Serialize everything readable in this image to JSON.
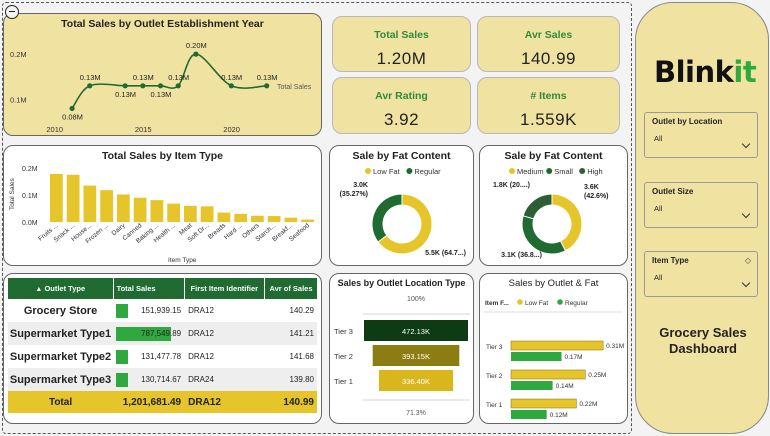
{
  "colors": {
    "yellow": "#e6c52a",
    "dark_green": "#1f6b32",
    "green": "#2fa83f",
    "olive": "#8b7d12",
    "card_bg": "#f0e3a2"
  },
  "kpis": [
    {
      "label": "Total Sales",
      "value": "1.20M"
    },
    {
      "label": "Avr Sales",
      "value": "140.99"
    },
    {
      "label": "Avr Rating",
      "value": "3.92"
    },
    {
      "label": "# Items",
      "value": "1.559K"
    }
  ],
  "sidebar": {
    "logo_main": "Blink",
    "logo_accent": "it",
    "slicers": [
      {
        "label": "Outlet by Location",
        "value": "All"
      },
      {
        "label": "Outlet Size",
        "value": "All"
      },
      {
        "label": "Item Type",
        "value": "All"
      }
    ],
    "title_line1": "Grocery Sales",
    "title_line2": "Dashboard"
  },
  "table": {
    "headers": [
      "Outlet Type",
      "Total Sales",
      "First Item Identifier",
      "Avr of Sales"
    ],
    "rows": [
      {
        "name": "Grocery Store",
        "sales": "151,939.15",
        "sales_frac": 0.19,
        "first": "DRA12",
        "avg": "140.29"
      },
      {
        "name": "Supermarket Type1",
        "sales": "787,549.89",
        "sales_frac": 1.0,
        "first": "DRA12",
        "avg": "141.21"
      },
      {
        "name": "Supermarket Type2",
        "sales": "131,477.78",
        "sales_frac": 0.17,
        "first": "DRA12",
        "avg": "141.68"
      },
      {
        "name": "Supermarket Type3",
        "sales": "130,714.67",
        "sales_frac": 0.17,
        "first": "DRA24",
        "avg": "139.80"
      }
    ],
    "total": {
      "name": "Total",
      "sales": "1,201,681.49",
      "first": "DRA12",
      "avg": "140.99"
    }
  },
  "chart_data": [
    {
      "id": "year",
      "type": "line",
      "title": "Total Sales by Outlet Establishment Year",
      "x": [
        2011,
        2012,
        2014,
        2015,
        2016,
        2017,
        2018,
        2020,
        2022
      ],
      "values": [
        0.08,
        0.13,
        0.13,
        0.13,
        0.13,
        0.13,
        0.2,
        0.13,
        0.13
      ],
      "point_labels": [
        "0.08M",
        "0.13M",
        "0.13M",
        "0.13M",
        "0.13M",
        "0.13M",
        "0.20M",
        "0.13M",
        "0.13M"
      ],
      "series": [
        {
          "name": "Total Sales"
        }
      ],
      "y_ticks": [
        "0.1M",
        "0.2M"
      ],
      "x_ticks": [
        "2010",
        "2015",
        "2020"
      ],
      "ylim": [
        0.05,
        0.24
      ]
    },
    {
      "id": "itemtype",
      "type": "bar",
      "title": "Total Sales by Item Type",
      "categories": [
        "Fruits ...",
        "Snack ...",
        "House...",
        "Frozen ...",
        "Dairy",
        "Canned",
        "Baking ...",
        "Health ...",
        "Meat",
        "Soft Dr...",
        "Breads",
        "Hard ...",
        "Others",
        "Starch...",
        "Breakf...",
        "Seafood"
      ],
      "values": [
        0.178,
        0.175,
        0.135,
        0.118,
        0.102,
        0.09,
        0.081,
        0.068,
        0.06,
        0.058,
        0.035,
        0.03,
        0.023,
        0.022,
        0.016,
        0.009
      ],
      "xlabel": "Item Type",
      "ylabel": "Total Sales",
      "y_ticks": [
        "0.0M",
        "0.1M",
        "0.2M"
      ],
      "ylim": [
        0,
        0.2
      ]
    },
    {
      "id": "fat",
      "type": "pie",
      "title": "Sale by Fat Content",
      "legend": [
        "Low Fat",
        "Regular"
      ],
      "values": [
        64.73,
        35.27
      ],
      "labels": [
        "5.5K (64.7...)",
        "3.0K\n(35.27%)"
      ],
      "colors": [
        "#e6c52a",
        "#1f6b32"
      ]
    },
    {
      "id": "size",
      "type": "pie",
      "title": "Sale by Fat Content",
      "legend": [
        "Medium",
        "Small",
        "High"
      ],
      "values": [
        42.6,
        36.8,
        20.6
      ],
      "labels": [
        "3.6K\n(42.6%)",
        "3.1K (36.8...)",
        "1.8K (20....)"
      ],
      "colors": [
        "#e6c52a",
        "#1f6b32",
        "#2e5e34"
      ]
    },
    {
      "id": "location",
      "type": "bar",
      "title": "Sales by Outlet Location Type",
      "categories": [
        "Tier 3",
        "Tier 2",
        "Tier 1"
      ],
      "values": [
        472.13,
        393.15,
        336.4
      ],
      "value_labels": [
        "472.13K",
        "393.15K",
        "336.40K"
      ],
      "top_label": "100%",
      "bottom_label": "71.3%",
      "colors": [
        "#0d3b14",
        "#8b7d12",
        "#d9b71c"
      ]
    },
    {
      "id": "outletfat",
      "type": "bar",
      "title": "Sales by Outlet & Fat",
      "legend_title": "Item F...",
      "categories": [
        "Tier 3",
        "Tier 2",
        "Tier 1"
      ],
      "series": [
        {
          "name": "Low Fat",
          "values": [
            0.31,
            0.25,
            0.22
          ],
          "labels": [
            "0.31M",
            "0.25M",
            "0.22M"
          ]
        },
        {
          "name": "Regular",
          "values": [
            0.17,
            0.14,
            0.12
          ],
          "labels": [
            "0.17M",
            "0.14M",
            "0.12M"
          ]
        }
      ],
      "xlim": [
        0,
        0.35
      ]
    }
  ]
}
